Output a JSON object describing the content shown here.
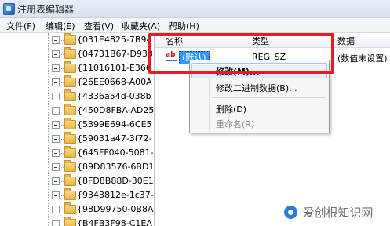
{
  "window": {
    "title": "注册表编辑器"
  },
  "menu": [
    "文件(F)",
    "编辑(E)",
    "查看(V)",
    "收藏夹(A)",
    "帮助(H)"
  ],
  "tree": {
    "items": [
      "{031E4825-7B94",
      "{04731B67-D933",
      "{11016101-E366",
      "{26EE0668-A00A",
      "{4336a54d-038b",
      "{450D8FBA-AD25",
      "{5399E694-6CE5",
      "{59031a47-3f72-",
      "{645FF040-5081-",
      "{89D83576-6BD1",
      "{8FD8B88D-30E1",
      "{9343812e-1c37-",
      "{98D99750-0B8A",
      "{B4FB3F98-C1EA"
    ]
  },
  "values_list": {
    "columns": {
      "name": "名称",
      "type": "类型",
      "data": "数据"
    },
    "rows": [
      {
        "icon": "string-value-icon",
        "icon_text": "ab",
        "name": "(默认)",
        "type": "REG_SZ",
        "data": "(数值未设置)"
      }
    ]
  },
  "context_menu": {
    "items": [
      {
        "label": "修改(M)...",
        "state": "highlighted"
      },
      {
        "label": "修改二进制数据(B)...",
        "state": "normal"
      },
      {
        "label": "删除(D)",
        "state": "normal"
      },
      {
        "label": "重命名(R)",
        "state": "disabled"
      }
    ]
  },
  "annotation": {
    "color": "#e01e24",
    "shape": "rectangle"
  },
  "watermark": {
    "text": "爱创根知识网"
  },
  "colors": {
    "selection": "#3399ff",
    "highlight_border": "#a9c8ee"
  }
}
